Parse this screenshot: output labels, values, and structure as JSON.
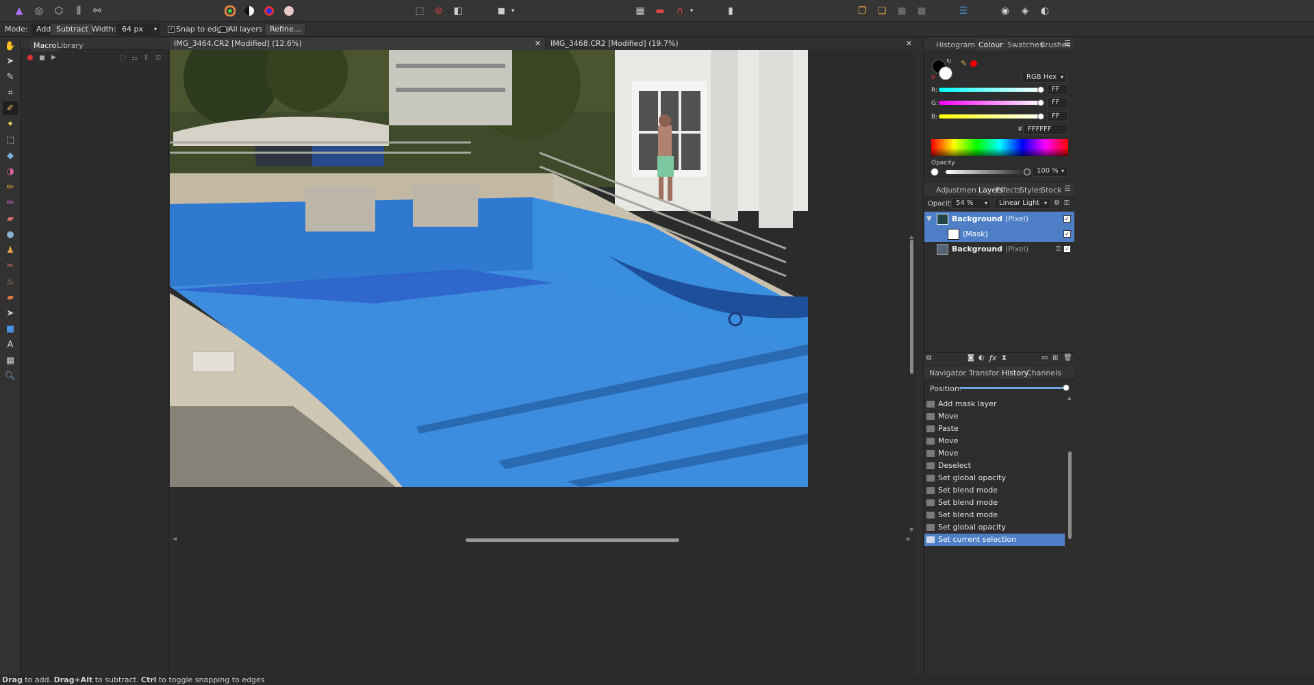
{
  "context_bar": {
    "mode_label": "Mode:",
    "mode_add": "Add",
    "mode_subtract": "Subtract",
    "width_label": "Width:",
    "width_value": "64 px",
    "snap_label": "Snap to edges",
    "all_layers_label": "All layers",
    "refine_label": "Refine..."
  },
  "left_panel": {
    "tabs": [
      "Macro",
      "Library"
    ]
  },
  "documents": {
    "tab1": "IMG_3464.CR2 [Modified] (12.6%)",
    "tab2": "IMG_3468.CR2 [Modified] (19.7%)"
  },
  "colour_panel": {
    "tabs": [
      "Histogram",
      "Colour",
      "Swatches",
      "Brushes"
    ],
    "mode": "RGB Hex",
    "r_label": "R:",
    "r_value": "FF",
    "g_label": "G:",
    "g_value": "FF",
    "b_label": "B:",
    "b_value": "FF",
    "hex_label": "#:",
    "hex_value": "FFFFFF",
    "opacity_label": "Opacity",
    "opacity_value": "100 %"
  },
  "layers_panel": {
    "tabs": [
      "Adjustment",
      "Layers",
      "Effects",
      "Styles",
      "Stock"
    ],
    "opacity_label": "Opacity:",
    "opacity_value": "54 %",
    "blend_mode": "Linear Light",
    "layers": [
      {
        "name": "Background",
        "type": "(Pixel)"
      },
      {
        "name": "(Mask)",
        "type": ""
      },
      {
        "name": "Background",
        "type": "(Pixel)"
      }
    ]
  },
  "history_panel": {
    "tabs": [
      "Navigator",
      "Transform",
      "History",
      "Channels"
    ],
    "position_label": "Position:",
    "items": [
      "Add mask layer",
      "Move",
      "Paste",
      "Move",
      "Move",
      "Deselect",
      "Set global opacity",
      "Set blend mode",
      "Set blend mode",
      "Set blend mode",
      "Set global opacity",
      "Set current selection"
    ]
  },
  "status": {
    "b1": "Drag",
    "t1": " to add. ",
    "b2": "Drag+Alt",
    "t2": " to subtract. ",
    "b3": "Ctrl",
    "t3": " to toggle snapping to edges"
  }
}
